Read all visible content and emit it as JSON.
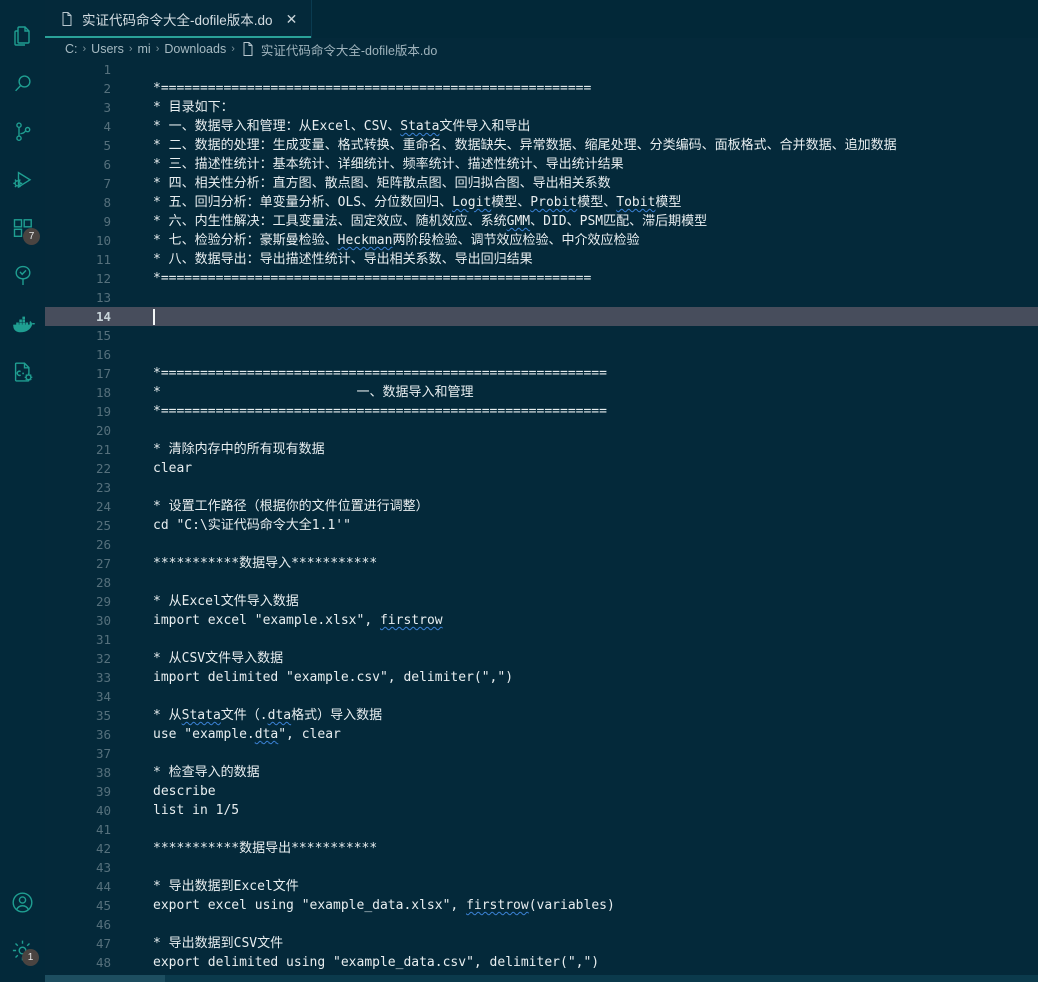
{
  "colors": {
    "editor_bg": "#04293a",
    "activity_bg": "#03293a",
    "accent": "#2aa198",
    "current_line": "#474d5c",
    "line_number": "#55707c",
    "text": "#e8eef0",
    "squiggle": "#3b82d6",
    "badge_bg": "#4a4441"
  },
  "activity_bar": {
    "top_items": [
      {
        "name": "explorer-icon",
        "title": "Explorer",
        "badge": null
      },
      {
        "name": "search-icon",
        "title": "Search",
        "badge": null
      },
      {
        "name": "source-control-icon",
        "title": "Source Control",
        "badge": null
      },
      {
        "name": "run-debug-icon",
        "title": "Run and Debug",
        "badge": null
      },
      {
        "name": "extensions-icon",
        "title": "Extensions",
        "badge": "7"
      },
      {
        "name": "testing-icon",
        "title": "Testing",
        "badge": null
      },
      {
        "name": "docker-icon",
        "title": "Docker",
        "badge": null
      },
      {
        "name": "cpp-config-icon",
        "title": "C/C++ Configuration",
        "badge": null
      }
    ],
    "bottom_items": [
      {
        "name": "account-icon",
        "title": "Accounts",
        "badge": null
      },
      {
        "name": "settings-gear-icon",
        "title": "Manage",
        "badge": "1"
      }
    ]
  },
  "tabs": [
    {
      "label": "实证代码命令大全-dofile版本.do",
      "icon": "file-icon",
      "close_label": "✕",
      "active": true
    }
  ],
  "breadcrumb": {
    "separator": "›",
    "items": [
      "C:",
      "Users",
      "mi",
      "Downloads"
    ],
    "file": "实证代码命令大全-dofile版本.do"
  },
  "editor": {
    "current_line": 14,
    "first_visible_line": 1,
    "lines": [
      {
        "n": 1,
        "text": ""
      },
      {
        "n": 2,
        "text": "*======================================================="
      },
      {
        "n": 3,
        "text": "* 目录如下："
      },
      {
        "n": 4,
        "text": "* 一、数据导入和管理：从Excel、CSV、Stata文件导入和导出"
      },
      {
        "n": 5,
        "text": "* 二、数据的处理：生成变量、格式转换、重命名、数据缺失、异常数据、缩尾处理、分类编码、面板格式、合并数据、追加数据"
      },
      {
        "n": 6,
        "text": "* 三、描述性统计：基本统计、详细统计、频率统计、描述性统计、导出统计结果"
      },
      {
        "n": 7,
        "text": "* 四、相关性分析：直方图、散点图、矩阵散点图、回归拟合图、导出相关系数"
      },
      {
        "n": 8,
        "text": "* 五、回归分析：单变量分析、OLS、分位数回归、Logit模型、Probit模型、Tobit模型"
      },
      {
        "n": 9,
        "text": "* 六、内生性解决：工具变量法、固定效应、随机效应、系统GMM、DID、PSM匹配、滞后期模型"
      },
      {
        "n": 10,
        "text": "* 七、检验分析：豪斯曼检验、Heckman两阶段检验、调节效应检验、中介效应检验"
      },
      {
        "n": 11,
        "text": "* 八、数据导出：导出描述性统计、导出相关系数、导出回归结果"
      },
      {
        "n": 12,
        "text": "*======================================================="
      },
      {
        "n": 13,
        "text": ""
      },
      {
        "n": 14,
        "text": ""
      },
      {
        "n": 15,
        "text": ""
      },
      {
        "n": 16,
        "text": ""
      },
      {
        "n": 17,
        "text": "*========================================================="
      },
      {
        "n": 18,
        "text": "*                         一、数据导入和管理"
      },
      {
        "n": 19,
        "text": "*========================================================="
      },
      {
        "n": 20,
        "text": ""
      },
      {
        "n": 21,
        "text": "* 清除内存中的所有现有数据"
      },
      {
        "n": 22,
        "text": "clear"
      },
      {
        "n": 23,
        "text": ""
      },
      {
        "n": 24,
        "text": "* 设置工作路径（根据你的文件位置进行调整）"
      },
      {
        "n": 25,
        "text": "cd \"C:\\实证代码命令大全1.1'\""
      },
      {
        "n": 26,
        "text": ""
      },
      {
        "n": 27,
        "text": "***********数据导入***********"
      },
      {
        "n": 28,
        "text": ""
      },
      {
        "n": 29,
        "text": "* 从Excel文件导入数据"
      },
      {
        "n": 30,
        "text": "import excel \"example.xlsx\", firstrow"
      },
      {
        "n": 31,
        "text": ""
      },
      {
        "n": 32,
        "text": "* 从CSV文件导入数据"
      },
      {
        "n": 33,
        "text": "import delimited \"example.csv\", delimiter(\",\")"
      },
      {
        "n": 34,
        "text": ""
      },
      {
        "n": 35,
        "text": "* 从Stata文件（.dta格式）导入数据"
      },
      {
        "n": 36,
        "text": "use \"example.dta\", clear"
      },
      {
        "n": 37,
        "text": ""
      },
      {
        "n": 38,
        "text": "* 检查导入的数据"
      },
      {
        "n": 39,
        "text": "describe"
      },
      {
        "n": 40,
        "text": "list in 1/5"
      },
      {
        "n": 41,
        "text": ""
      },
      {
        "n": 42,
        "text": "***********数据导出***********"
      },
      {
        "n": 43,
        "text": ""
      },
      {
        "n": 44,
        "text": "* 导出数据到Excel文件"
      },
      {
        "n": 45,
        "text": "export excel using \"example_data.xlsx\", firstrow(variables)"
      },
      {
        "n": 46,
        "text": ""
      },
      {
        "n": 47,
        "text": "* 导出数据到CSV文件"
      },
      {
        "n": 48,
        "text": "export delimited using \"example_data.csv\", delimiter(\",\")"
      }
    ],
    "spellcheck_words": [
      "Stata",
      "Logit",
      "Probit",
      "Tobit",
      "GMM",
      "Heckman",
      "firstrow",
      "dta"
    ]
  }
}
